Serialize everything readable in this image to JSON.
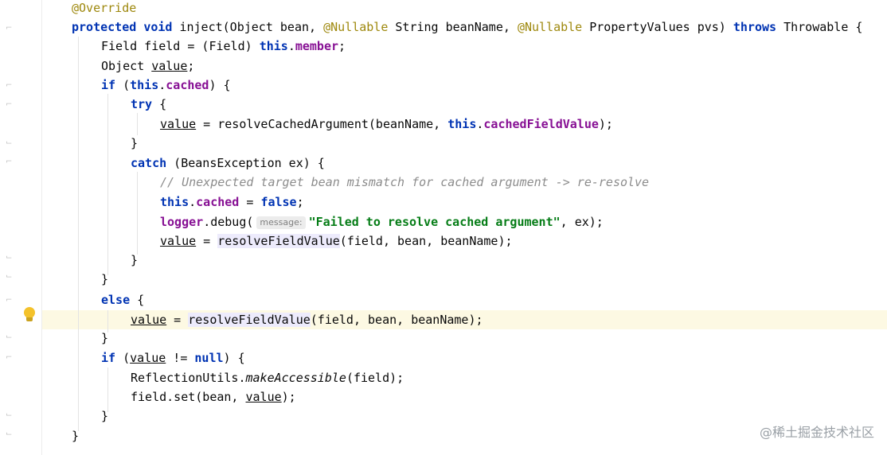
{
  "editor": {
    "watermark": "@稀土掘金技术社区",
    "lines": {
      "l1": {
        "annotation": "@Override"
      },
      "l2": {
        "kw_protected": "protected",
        "kw_void": "void",
        "text_a": " inject(Object bean, ",
        "ann_nullable_1": "@Nullable",
        "text_b": " String beanName, ",
        "ann_nullable_2": "@Nullable",
        "text_c": " PropertyValues pvs) ",
        "kw_throws": "throws",
        "text_d": " Throwable {"
      },
      "l3": {
        "text_a": "Field field = (Field) ",
        "kw_this": "this",
        "dot": ".",
        "field_member": "member",
        "text_b": ";"
      },
      "l4": {
        "text_a": "Object ",
        "var_value": "value",
        "text_b": ";"
      },
      "l5": {
        "kw_if": "if",
        "text_a": " (",
        "kw_this": "this",
        "dot": ".",
        "field_cached": "cached",
        "text_b": ") {"
      },
      "l6": {
        "kw_try": "try",
        "text_a": " {"
      },
      "l7": {
        "var_value": "value",
        "text_a": " = resolveCachedArgument(beanName, ",
        "kw_this": "this",
        "dot": ".",
        "field_cached_value": "cachedFieldValue",
        "text_b": ");"
      },
      "l8": {
        "text_a": "}"
      },
      "l9": {
        "kw_catch": "catch",
        "text_a": " (BeansException ex) {"
      },
      "l10": {
        "comment": "// Unexpected target bean mismatch for cached argument -> re-resolve"
      },
      "l11": {
        "kw_this": "this",
        "dot": ".",
        "field_cached": "cached",
        "text_a": " = ",
        "kw_false": "false",
        "text_b": ";"
      },
      "l12": {
        "fld_logger": "logger",
        "text_a": ".debug(",
        "hint": "message:",
        "str": "\"Failed to resolve cached argument\"",
        "text_b": ", ex);"
      },
      "l13": {
        "var_value": "value",
        "text_a": " = ",
        "method": "resolveFieldValue",
        "text_b": "(field, bean, beanName);"
      },
      "l14": {
        "text_a": "}"
      },
      "l15": {
        "text_a": "}"
      },
      "l16": {
        "kw_else": "else",
        "text_a": " {"
      },
      "l17": {
        "var_value": "value",
        "text_a": " = ",
        "method": "resolveFieldValue",
        "text_b": "(field, bean, beanName);"
      },
      "l18": {
        "text_a": "}"
      },
      "l19": {
        "kw_if": "if",
        "text_a": " (",
        "var_value": "value",
        "text_b": " != ",
        "kw_null": "null",
        "text_c": ") {"
      },
      "l20": {
        "text_a": "ReflectionUtils.",
        "method": "makeAccessible",
        "text_b": "(field);"
      },
      "l21": {
        "text_a": "field.set(bean, ",
        "var_value": "value",
        "text_b": ");"
      },
      "l22": {
        "text_a": "}"
      },
      "l23": {
        "text_a": "}"
      }
    }
  }
}
